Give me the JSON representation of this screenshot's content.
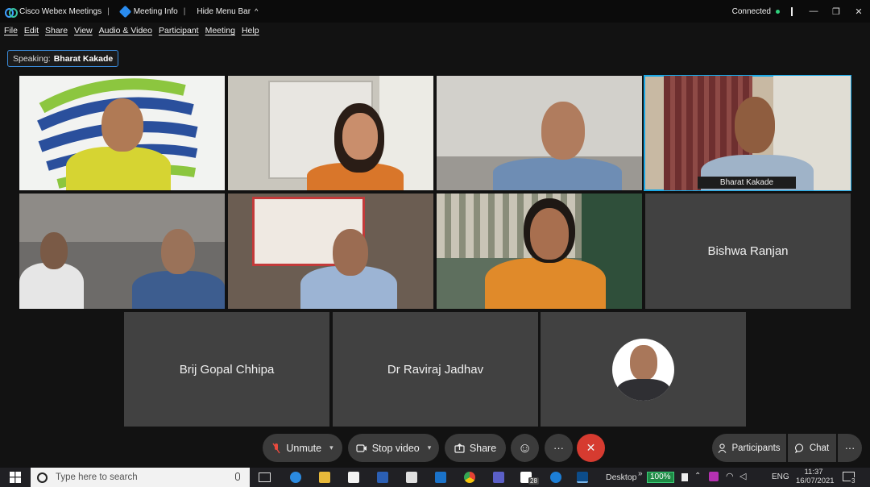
{
  "titlebar": {
    "app_name": "Cisco Webex Meetings",
    "meeting_info": "Meeting Info",
    "hide_menu": "Hide Menu Bar",
    "hide_menu_chevron": "^",
    "separator": "|",
    "status": "Connected",
    "status_color": "#2fd07c",
    "minimize": "—",
    "restore": "❐",
    "close": "✕"
  },
  "menu": [
    "File",
    "Edit",
    "Share",
    "View",
    "Audio & Video",
    "Participant",
    "Meeting",
    "Help"
  ],
  "speaking": {
    "prefix": "Speaking:",
    "name": "Bharat Kakade"
  },
  "tiles": [
    {
      "name": "",
      "type": "video"
    },
    {
      "name": "",
      "type": "video"
    },
    {
      "name": "",
      "type": "video"
    },
    {
      "name": "Bharat Kakade",
      "type": "video",
      "active": true
    },
    {
      "name": "",
      "type": "video"
    },
    {
      "name": "",
      "type": "video"
    },
    {
      "name": "",
      "type": "video"
    },
    {
      "name": "Bishwa Ranjan",
      "type": "name-only"
    },
    {
      "name": "Brij Gopal Chhipa",
      "type": "name-only"
    },
    {
      "name": "Dr Raviraj Jadhav",
      "type": "name-only"
    },
    {
      "name": "",
      "type": "avatar"
    }
  ],
  "controls": {
    "unmute": "Unmute",
    "stop_video": "Stop video",
    "share": "Share",
    "reactions_icon": "☺",
    "more": "···",
    "leave_icon": "✕",
    "participants": "Participants",
    "chat": "Chat",
    "panel_more": "···",
    "accent_red": "#d63b30"
  },
  "taskbar": {
    "search_placeholder": "Type here to search",
    "desktop": "Desktop",
    "battery": "100%",
    "language": "ENG",
    "time": "11:37",
    "date": "16/07/2021",
    "mail_badge": "28",
    "notification_count": "3"
  }
}
